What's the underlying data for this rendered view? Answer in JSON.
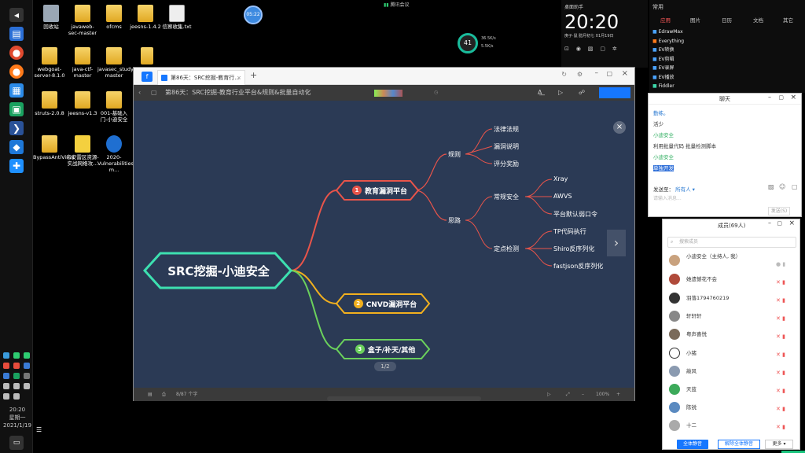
{
  "taskbar": {
    "clock_time": "20:20",
    "clock_day": "星期一",
    "clock_date": "2021/1/19"
  },
  "desktop_icons": [
    {
      "label": "回收站"
    },
    {
      "label": "javaweb-sec-master"
    },
    {
      "label": "ofcms"
    },
    {
      "label": "jeesns-1.4.2"
    },
    {
      "label": "信察收集.txt"
    },
    {
      "label": "webgoat-server-8.1.0"
    },
    {
      "label": "java-ctf-master"
    },
    {
      "label": "javasec_study-master"
    },
    {
      "label": "struts-2.0.8"
    },
    {
      "label": "jeesns-v1.3"
    },
    {
      "label": "001-基础入门-小迪安全"
    },
    {
      "label": "BypassAntiVirus"
    },
    {
      "label": "帝安雷区资源-实战网络攻..."
    },
    {
      "label": "2020-Vulnerabilities-m..."
    }
  ],
  "top_timer": "05:22",
  "meeting_label": "腾讯会议",
  "cpu": {
    "percent": "41",
    "up": "36.5K/s",
    "down": "5.5K/s"
  },
  "clock_widget": {
    "time": "20:20",
    "label": "桌面助手",
    "date_line": "庚子·鼠  腊月初七  01月19日"
  },
  "right_panel": {
    "header": "常用",
    "tabs": [
      "应用",
      "图片",
      "日历",
      "文档",
      "其它"
    ],
    "apps": [
      "EdrawMax",
      "Everything",
      "EV转换",
      "EV剪辑",
      "EV录屏",
      "EV播放",
      "Fiddler"
    ]
  },
  "browser": {
    "tab_title": "第86天：SRC挖掘-教育行...",
    "toolbar_title": "第86天：SRC挖掘-教育行业平台&规则&批量自动化",
    "page_indicator": "1/2",
    "status_text": "8/87 个字",
    "zoom": "100%"
  },
  "mindmap": {
    "root": "SRC挖掘-小迪安全",
    "branch1": {
      "num": "1",
      "label": "教育漏洞平台"
    },
    "branch2": {
      "num": "2",
      "label": "CNVD漏洞平台"
    },
    "branch3": {
      "num": "3",
      "label": "盒子/补天/其他"
    },
    "rules": "规则",
    "rules_items": [
      "法律法规",
      "漏洞说明",
      "评分奖励"
    ],
    "ideas": "思路",
    "regular": "常规安全",
    "regular_items": [
      "Xray",
      "AWVS",
      "平台默认弱口令"
    ],
    "point": "定点检测",
    "point_items": [
      "TP代码执行",
      "Shiro反序列化",
      "fastjson反序列化"
    ]
  },
  "chat": {
    "title": "聊天",
    "messages": [
      "勤练。",
      "活少",
      "小迪安全",
      "利用批量代码 批量检测脚本",
      "小迪安全",
      "单独开发"
    ],
    "send_to_label": "发送至：",
    "send_to_value": "所有人",
    "input_placeholder": "请输入消息...",
    "send_button": "发送(S)"
  },
  "members": {
    "title": "成员(69人)",
    "search_placeholder": "搜索成员",
    "list": [
      "小迪安全（主持人, 我）",
      "她遗憾花不会",
      "羽落1794760219",
      "轩轩轩",
      "粤声喜悦",
      "小猪",
      "敲风",
      "天蓝",
      "陈锐",
      "十二"
    ],
    "mute_all": "全体静音",
    "unmute_all": "解除全体静音",
    "more": "更多"
  },
  "colors": {
    "accent_green": "#19c37d",
    "root_node": "#3de0b0",
    "branch1": "#e8544a",
    "branch2": "#f2b01e",
    "branch3": "#6bd15c"
  }
}
